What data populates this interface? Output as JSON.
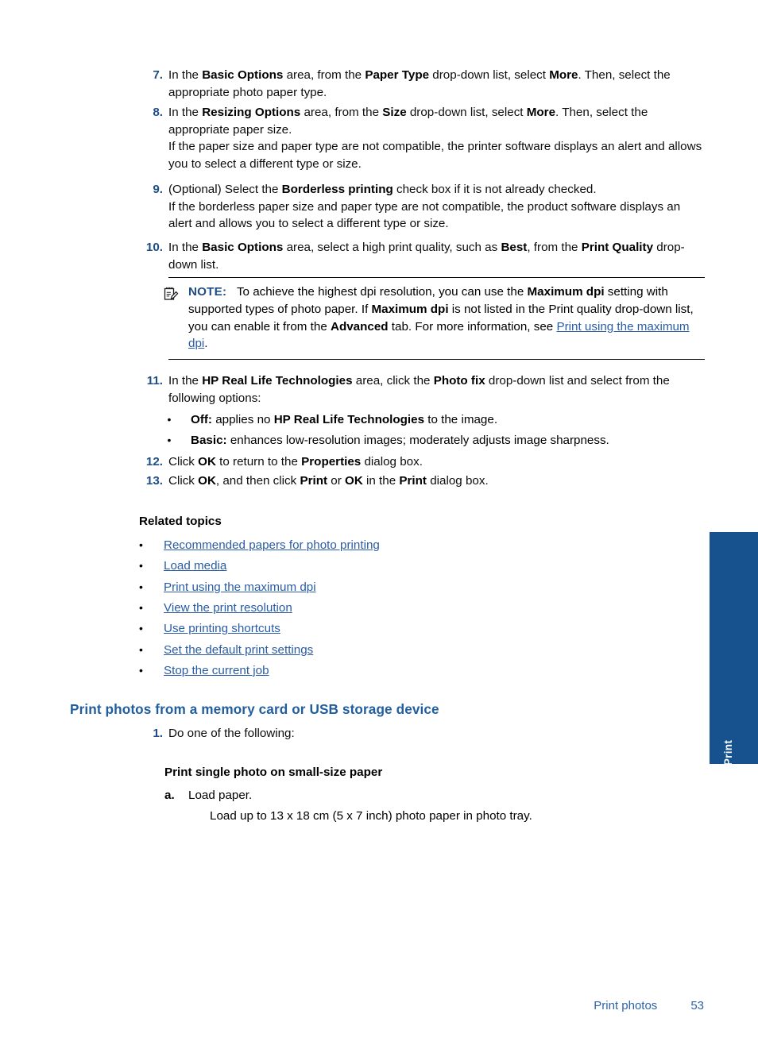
{
  "colors": {
    "heading_blue": "#215e9e",
    "number_blue": "#1f4e87",
    "link_blue": "#2a5ca5",
    "tab_blue": "#17528f",
    "footer_blue": "#2f63a8"
  },
  "steps": [
    {
      "num": "7.",
      "parts": [
        {
          "t": "In the ",
          "b": false
        },
        {
          "t": "Basic Options",
          "b": true
        },
        {
          "t": " area, from the ",
          "b": false
        },
        {
          "t": "Paper Type",
          "b": true
        },
        {
          "t": " drop-down list, select ",
          "b": false
        },
        {
          "t": "More",
          "b": true
        },
        {
          "t": ". Then, select the appropriate photo paper type.",
          "b": false
        }
      ]
    },
    {
      "num": "8.",
      "parts": [
        {
          "t": "In the ",
          "b": false
        },
        {
          "t": "Resizing Options",
          "b": true
        },
        {
          "t": " area, from the ",
          "b": false
        },
        {
          "t": "Size",
          "b": true
        },
        {
          "t": " drop-down list, select ",
          "b": false
        },
        {
          "t": "More",
          "b": true
        },
        {
          "t": ". Then, select the appropriate paper size.",
          "b": false
        },
        {
          "t": "\n",
          "b": false
        },
        {
          "t": "If the paper size and paper type are not compatible, the printer software displays an alert and allows you to select a different type or size.",
          "b": false
        }
      ]
    },
    {
      "num": "9.",
      "parts": [
        {
          "t": "(Optional) Select the ",
          "b": false
        },
        {
          "t": "Borderless printing",
          "b": true
        },
        {
          "t": " check box if it is not already checked.",
          "b": false
        },
        {
          "t": "\n",
          "b": false
        },
        {
          "t": "If the borderless paper size and paper type are not compatible, the product software displays an alert and allows you to select a different type or size.",
          "b": false
        }
      ]
    },
    {
      "num": "10.",
      "parts": [
        {
          "t": "In the ",
          "b": false
        },
        {
          "t": "Basic Options",
          "b": true
        },
        {
          "t": " area, select a high print quality, such as ",
          "b": false
        },
        {
          "t": "Best",
          "b": true
        },
        {
          "t": ", from the ",
          "b": false
        },
        {
          "t": "Print Quality",
          "b": true
        },
        {
          "t": " drop-down list.",
          "b": false
        }
      ]
    }
  ],
  "note": {
    "icon_name": "note-pencil-icon",
    "label": "NOTE:",
    "parts": [
      {
        "t": "To achieve the highest dpi resolution, you can use the ",
        "b": false
      },
      {
        "t": "Maximum dpi",
        "b": true
      },
      {
        "t": " setting with supported types of photo paper. If ",
        "b": false
      },
      {
        "t": "Maximum dpi",
        "b": true
      },
      {
        "t": " is not listed in the Print quality drop-down list, you can enable it from the ",
        "b": false
      },
      {
        "t": "Advanced",
        "b": true
      },
      {
        "t": " tab. For more information, see ",
        "b": false
      },
      {
        "t": "Print using the maximum dpi",
        "b": false,
        "link": true
      },
      {
        "t": ".",
        "b": false
      }
    ]
  },
  "step11": {
    "num": "11.",
    "parts": [
      {
        "t": "In the ",
        "b": false
      },
      {
        "t": "HP Real Life Technologies",
        "b": true
      },
      {
        "t": " area, click the ",
        "b": false
      },
      {
        "t": "Photo fix",
        "b": true
      },
      {
        "t": " drop-down list and select from the following options:",
        "b": false
      }
    ]
  },
  "step11_bullets": [
    {
      "bullet": "•",
      "parts": [
        {
          "t": "Off:",
          "b": true
        },
        {
          "t": " applies no ",
          "b": false
        },
        {
          "t": "HP Real Life Technologies",
          "b": true
        },
        {
          "t": " to the image.",
          "b": false
        }
      ]
    },
    {
      "bullet": "•",
      "parts": [
        {
          "t": "Basic:",
          "b": true
        },
        {
          "t": " enhances low-resolution images; moderately adjusts image sharpness.",
          "b": false
        }
      ]
    }
  ],
  "steps_tail": [
    {
      "num": "12.",
      "parts": [
        {
          "t": "Click ",
          "b": false
        },
        {
          "t": "OK",
          "b": true
        },
        {
          "t": " to return to the ",
          "b": false
        },
        {
          "t": "Properties",
          "b": true
        },
        {
          "t": " dialog box.",
          "b": false
        }
      ]
    },
    {
      "num": "13.",
      "parts": [
        {
          "t": "Click ",
          "b": false
        },
        {
          "t": "OK",
          "b": true
        },
        {
          "t": ", and then click ",
          "b": false
        },
        {
          "t": "Print",
          "b": true
        },
        {
          "t": " or ",
          "b": false
        },
        {
          "t": "OK",
          "b": true
        },
        {
          "t": " in the ",
          "b": false
        },
        {
          "t": "Print",
          "b": true
        },
        {
          "t": " dialog box.",
          "b": false
        }
      ]
    }
  ],
  "related_topics": {
    "title": "Related topics",
    "bullet": "•",
    "items": [
      "Recommended papers for photo printing",
      "Load media",
      "Print using the maximum dpi",
      "View the print resolution",
      "Use printing shortcuts",
      "Set the default print settings",
      "Stop the current job"
    ]
  },
  "section": {
    "heading": "Print photos from a memory card or USB storage device",
    "step1_num": "1.",
    "step1_text": "Do one of the following:",
    "sub_heading": "Print single photo on small-size paper",
    "step_a_letter": "a.",
    "step_a_text": "Load paper.",
    "step_a_detail": "Load up to 13 x 18 cm (5 x 7 inch) photo paper in photo tray."
  },
  "side_tab": {
    "label": "Print"
  },
  "footer": {
    "name": "Print photos",
    "page": "53"
  }
}
